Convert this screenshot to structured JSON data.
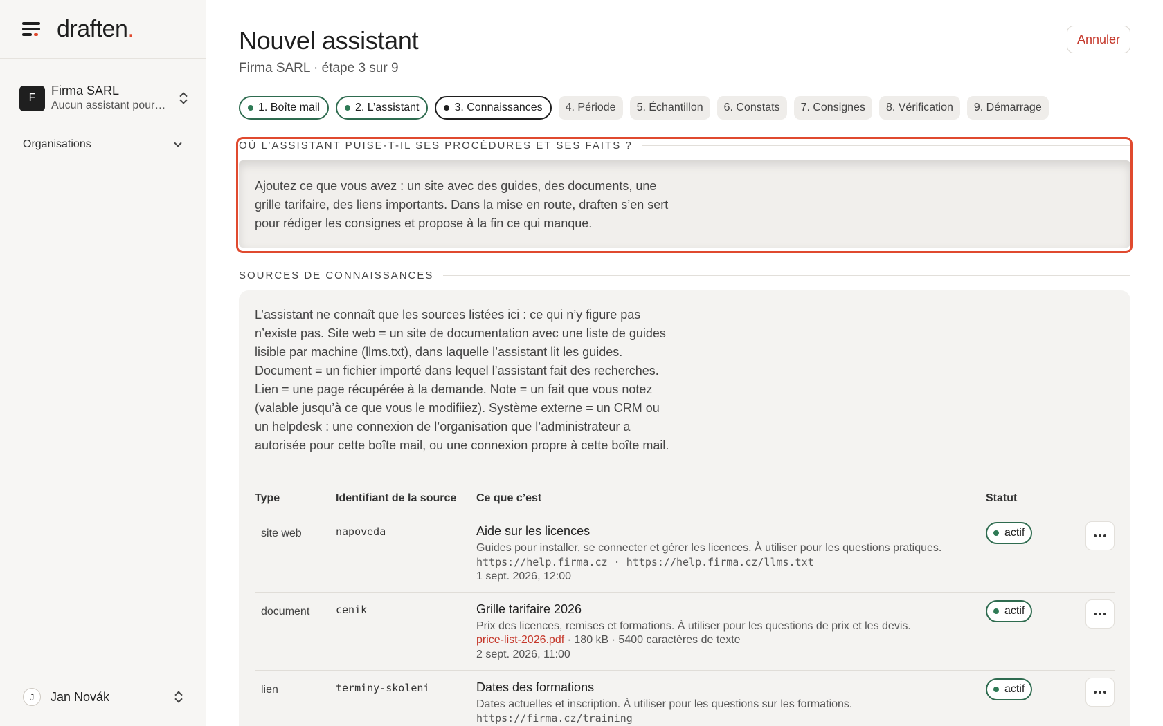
{
  "app": {
    "logo_text": "draften",
    "logo_dot": "."
  },
  "sidebar": {
    "org_initial": "F",
    "org_name": "Firma SARL",
    "org_sub": "Aucun assistant pour…",
    "section_label": "Organisations",
    "user_initial": "J",
    "user_name": "Jan Novák"
  },
  "header": {
    "title": "Nouvel assistant",
    "subtitle": "Firma SARL · étape 3 sur 9",
    "cancel_label": "Annuler"
  },
  "steps": [
    {
      "label": "1. Boîte mail",
      "state": "done"
    },
    {
      "label": "2. L’assistant",
      "state": "done"
    },
    {
      "label": "3. Connaissances",
      "state": "current"
    },
    {
      "label": "4. Période",
      "state": "todo"
    },
    {
      "label": "5. Échantillon",
      "state": "todo"
    },
    {
      "label": "6. Constats",
      "state": "todo"
    },
    {
      "label": "7. Consignes",
      "state": "todo"
    },
    {
      "label": "8. Vérification",
      "state": "todo"
    },
    {
      "label": "9. Démarrage",
      "state": "todo"
    }
  ],
  "intro": {
    "heading": "OÙ L’ASSISTANT PUISE-T-IL SES PROCÉDURES ET SES FAITS ?",
    "text": "Ajoutez ce que vous avez : un site avec des guides, des documents, une grille tarifaire, des liens importants. Dans la mise en route, draften s’en sert pour rédiger les consignes et propose à la fin ce qui manque."
  },
  "sources": {
    "heading": "SOURCES DE CONNAISSANCES",
    "description": "L’assistant ne connaît que les sources listées ici : ce qui n’y figure pas n’existe pas. Site web = un site de documentation avec une liste de guides lisible par machine (llms.txt), dans laquelle l’assistant lit les guides. Document = un fichier importé dans lequel l’assistant fait des recherches. Lien = une page récupérée à la demande. Note = un fait que vous notez (valable jusqu’à ce que vous le modifiiez). Système externe = un CRM ou un helpdesk : une connexion de l’organisation que l’administrateur a autorisée pour cette boîte mail, ou une connexion propre à cette boîte mail.",
    "columns": {
      "type": "Type",
      "id": "Identifiant de la source",
      "what": "Ce que c’est",
      "status": "Statut"
    },
    "rows": [
      {
        "type": "site web",
        "id": "napoveda",
        "title": "Aide sur les licences",
        "desc": "Guides pour installer, se connecter et gérer les licences. À utiliser pour les questions pratiques.",
        "meta": "https://help.firma.cz · https://help.firma.cz/llms.txt",
        "date": "1 sept. 2026, 12:00",
        "status": "actif"
      },
      {
        "type": "document",
        "id": "cenik",
        "title": "Grille tarifaire 2026",
        "desc": "Prix des licences, remises et formations. À utiliser pour les questions de prix et les devis.",
        "file": "price-list-2026.pdf",
        "file_info": " · 180 kB · 5400 caractères de texte",
        "date": "2 sept. 2026, 11:00",
        "status": "actif"
      },
      {
        "type": "lien",
        "id": "terminy-skoleni",
        "title": "Dates des formations",
        "desc": "Dates actuelles et inscription. À utiliser pour les questions sur les formations.",
        "meta": "https://firma.cz/training",
        "status": "actif"
      }
    ]
  },
  "colors": {
    "accent": "#e04a2f",
    "status_green": "#2e7a55",
    "danger_text": "#c5382b"
  }
}
